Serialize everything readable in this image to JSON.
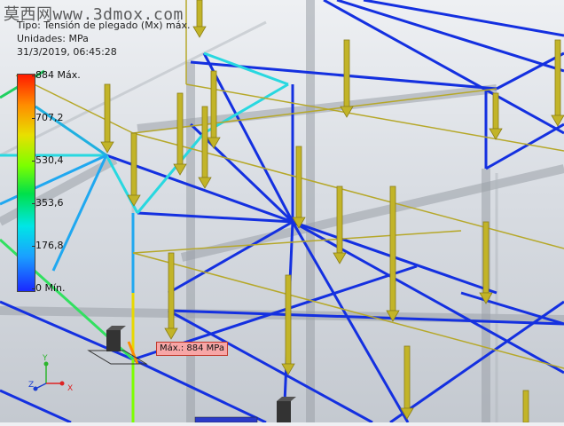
{
  "watermark": "莫西网www.3dmox.com",
  "info": {
    "line1": "Tipo: Tensión de plegado (Mx) máx.",
    "line2": "Unidades: MPa",
    "line3": "31/3/2019, 06:45:28"
  },
  "legend": {
    "ticks": [
      "884 Máx.",
      "707,2",
      "530,4",
      "353,6",
      "176,8",
      "0 Mín."
    ],
    "colors": [
      "#ff1a00",
      "#ff8c00",
      "#e8e000",
      "#7cff00",
      "#00e04a",
      "#00e6e6",
      "#1aa0ff",
      "#1a28ff"
    ]
  },
  "probe": {
    "label": "Máx.: 884 MPa"
  },
  "triad": {
    "x": "X",
    "y": "Y",
    "z": "Z"
  },
  "colors": {
    "frame": "#1430e0",
    "load_arrow": "#c2b428",
    "hot_member": "#28d8e0"
  }
}
